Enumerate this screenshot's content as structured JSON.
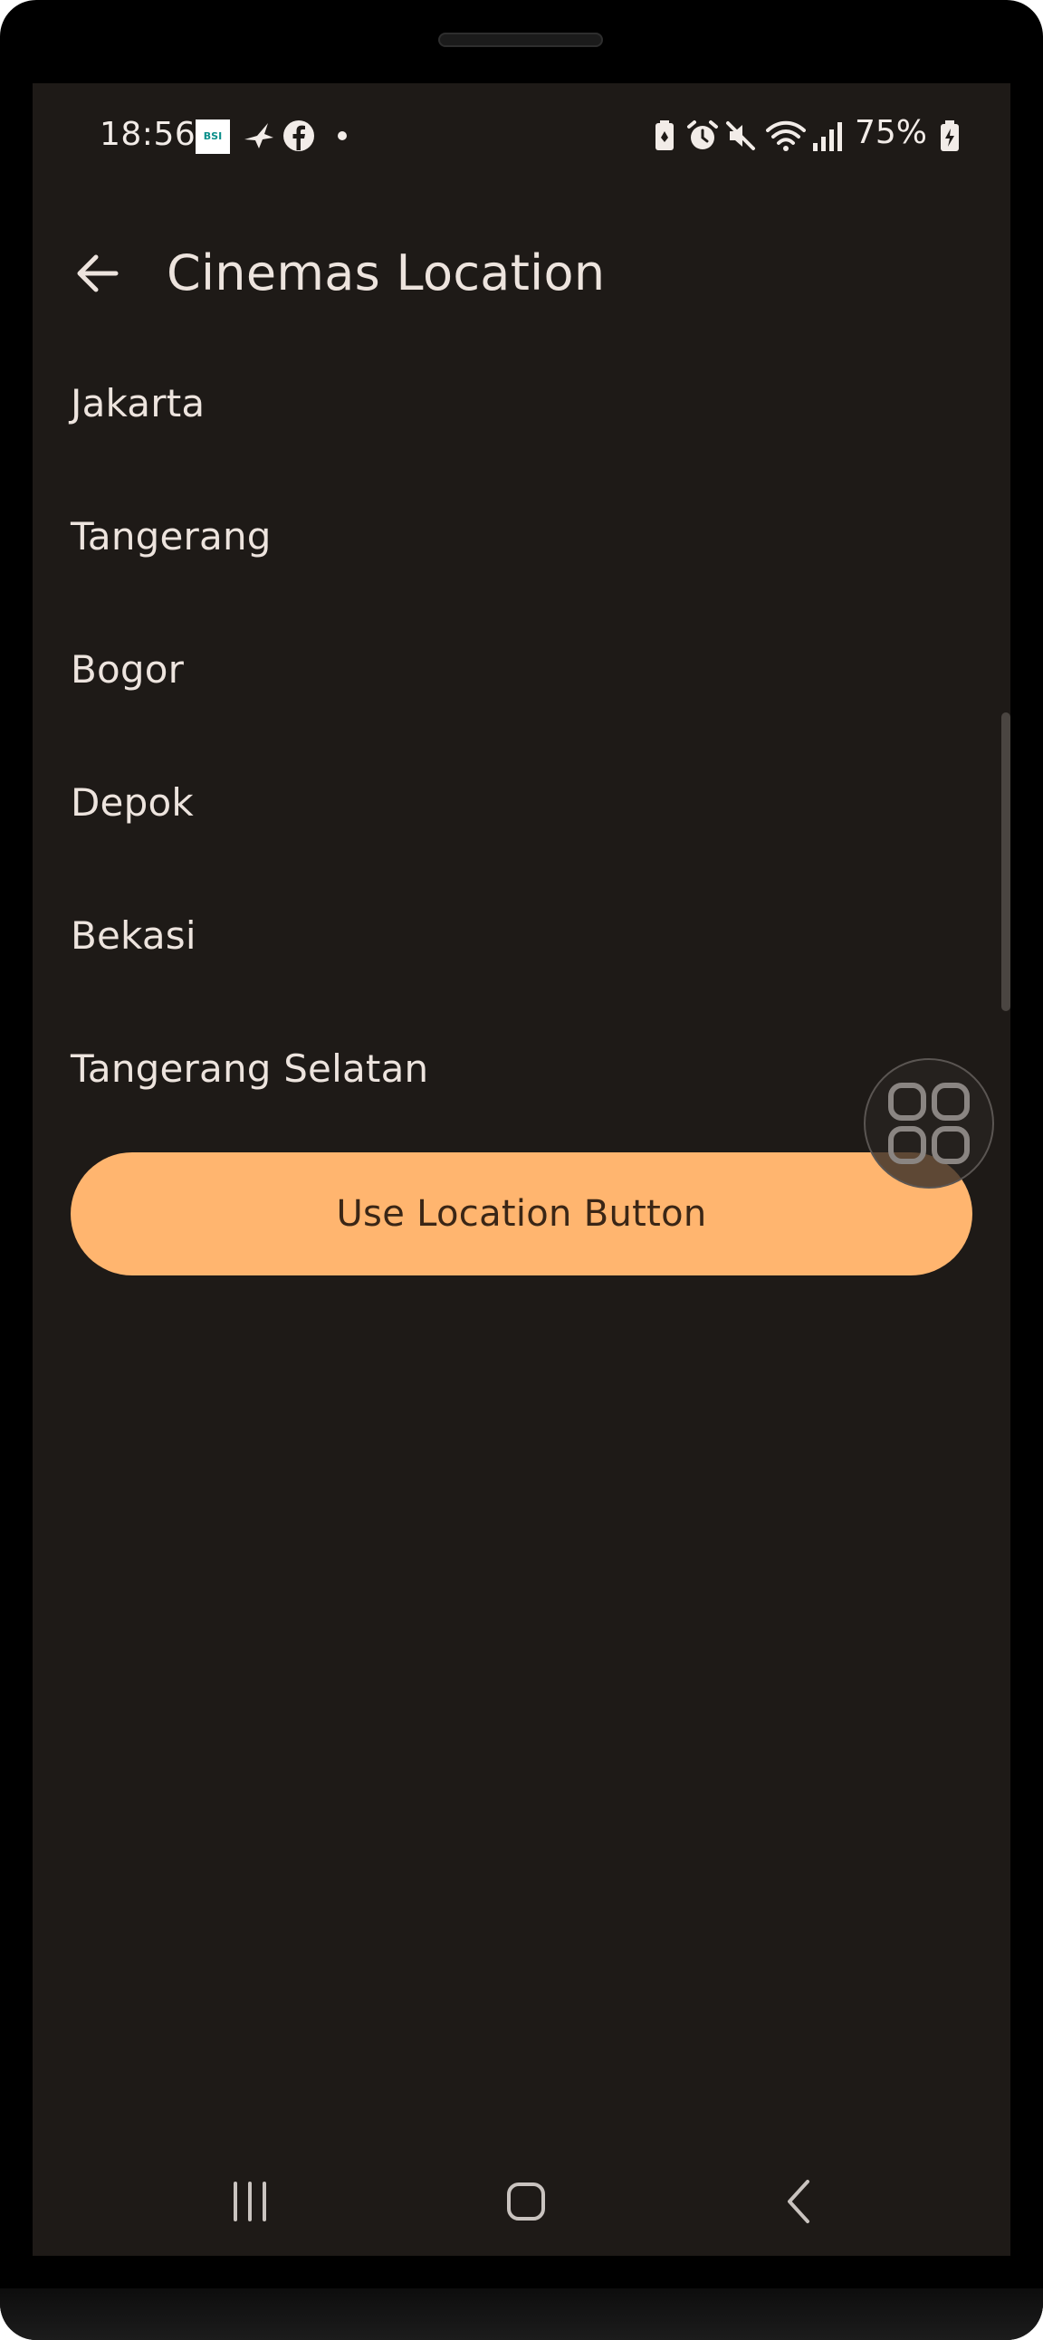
{
  "status_bar": {
    "time": "18:56",
    "bsi_label": "BSI",
    "battery_percent": "75%",
    "icons": [
      "bsi-app-icon",
      "bird-app-icon",
      "facebook-icon",
      "dot-icon",
      "battery-saver-icon",
      "alarm-icon",
      "mute-icon",
      "wifi-icon",
      "signal-icon",
      "battery-charging-icon"
    ]
  },
  "app_bar": {
    "title": "Cinemas Location",
    "back_icon": "arrow-back-icon"
  },
  "cities": [
    {
      "label": "Jakarta"
    },
    {
      "label": "Tangerang"
    },
    {
      "label": "Bogor"
    },
    {
      "label": "Depok"
    },
    {
      "label": "Bekasi"
    },
    {
      "label": "Tangerang Selatan"
    }
  ],
  "use_location_button": {
    "label": "Use Location Button"
  },
  "floating_button": {
    "icon": "apps-grid-icon"
  },
  "nav_bar": {
    "recents_icon": "recents-icon",
    "home_icon": "home-icon",
    "back_icon": "back-chevron-icon"
  },
  "colors": {
    "background": "#1e1a17",
    "text": "#ede4de",
    "accent_button": "#ffb56f",
    "button_text": "#3a2616"
  }
}
